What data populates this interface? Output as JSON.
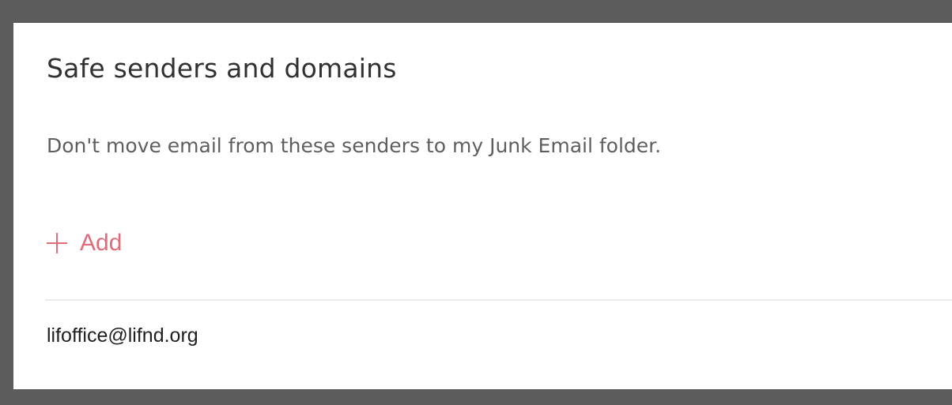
{
  "section": {
    "title": "Safe senders and domains",
    "description": "Don't move email from these senders to my Junk Email folder.",
    "add_label": "Add"
  },
  "senders": [
    "lifoffice@lifnd.org"
  ],
  "colors": {
    "accent": "#e06b7a",
    "frame": "#5c5c5c",
    "panel": "#ffffff",
    "title_text": "#323130",
    "secondary_text": "#605e5c",
    "divider": "#edebe9"
  },
  "icons": {
    "add": "plus-icon"
  }
}
